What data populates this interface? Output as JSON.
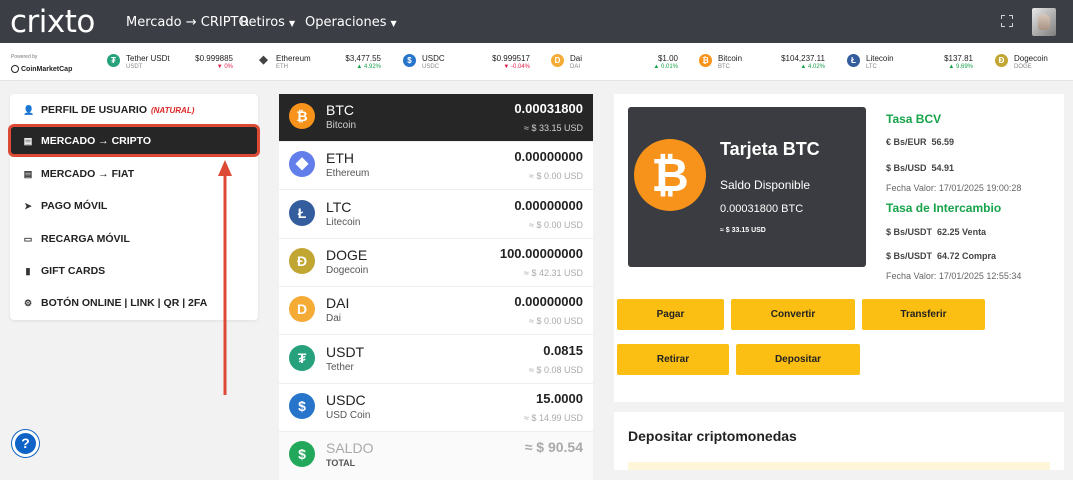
{
  "app": {
    "logo": "crixto",
    "nav": {
      "mercado": "Mercado → CRIPTO",
      "retiros": "Retiros",
      "operaciones": "Operaciones"
    }
  },
  "ticker": {
    "powered_by": "Powered by",
    "provider": "CoinMarketCap",
    "items": [
      {
        "name": "Tether USDt",
        "symbol": "USDT",
        "price": "$0.999885",
        "change": "▼ 0%",
        "dir": "down",
        "color": "#26a17b"
      },
      {
        "name": "Ethereum",
        "symbol": "ETH",
        "price": "$3,477.55",
        "change": "▲ 4.92%",
        "dir": "up",
        "color": "#627eea"
      },
      {
        "name": "USDC",
        "symbol": "USDC",
        "price": "$0.999517",
        "change": "▼ -0.04%",
        "dir": "down",
        "color": "#2775ca"
      },
      {
        "name": "Dai",
        "symbol": "DAI",
        "price": "$1.00",
        "change": "▲ 0.01%",
        "dir": "up",
        "color": "#f5ac37"
      },
      {
        "name": "Bitcoin",
        "symbol": "BTC",
        "price": "$104,237.11",
        "change": "▲ 4.02%",
        "dir": "up",
        "color": "#f7931a"
      },
      {
        "name": "Litecoin",
        "symbol": "LTC",
        "price": "$137.81",
        "change": "▲ 9.69%",
        "dir": "up",
        "color": "#345d9d"
      },
      {
        "name": "Dogecoin",
        "symbol": "DOGE",
        "price": "",
        "change": "",
        "dir": "up",
        "color": "#c2a633"
      }
    ]
  },
  "sidebar": {
    "items": [
      {
        "label": "PERFIL DE USUARIO",
        "tag": "(NATURAL)"
      },
      {
        "label": "MERCADO → CRIPTO"
      },
      {
        "label": "MERCADO → FIAT"
      },
      {
        "label": "PAGO MÓVIL"
      },
      {
        "label": "RECARGA MÓVIL"
      },
      {
        "label": "GIFT CARDS"
      },
      {
        "label": "BOTÓN ONLINE | LINK | QR | 2FA"
      }
    ]
  },
  "wallet": {
    "coins": [
      {
        "symbol": "BTC",
        "name": "Bitcoin",
        "amount": "0.00031800",
        "usd": "≈ $ 33.15 USD",
        "color": "#f7931a",
        "glyph": "₿"
      },
      {
        "symbol": "ETH",
        "name": "Ethereum",
        "amount": "0.00000000",
        "usd": "≈ $ 0.00 USD",
        "color": "#627eea",
        "glyph": "◆"
      },
      {
        "symbol": "LTC",
        "name": "Litecoin",
        "amount": "0.00000000",
        "usd": "≈ $ 0.00 USD",
        "color": "#345d9d",
        "glyph": "Ł"
      },
      {
        "symbol": "DOGE",
        "name": "Dogecoin",
        "amount": "100.00000000",
        "usd": "≈ $ 42.31 USD",
        "color": "#c2a633",
        "glyph": "Ð"
      },
      {
        "symbol": "DAI",
        "name": "Dai",
        "amount": "0.00000000",
        "usd": "≈ $ 0.00 USD",
        "color": "#f5ac37",
        "glyph": "D"
      },
      {
        "symbol": "USDT",
        "name": "Tether",
        "amount": "0.0815",
        "usd": "≈ $ 0.08 USD",
        "color": "#26a17b",
        "glyph": "₮"
      },
      {
        "symbol": "USDC",
        "name": "USD Coin",
        "amount": "15.0000",
        "usd": "≈ $ 14.99 USD",
        "color": "#2775ca",
        "glyph": "$"
      }
    ],
    "total": {
      "label": "SALDO",
      "sub": "TOTAL",
      "amount": "≈ $ 90.54",
      "color": "#22a85a",
      "glyph": "$"
    }
  },
  "card": {
    "title": "Tarjeta BTC",
    "balance_label": "Saldo Disponible",
    "balance": "0.00031800 BTC",
    "balance_usd": "≈ $ 33.15 USD"
  },
  "rates": {
    "bcv_title": "Tasa BCV",
    "eur_label": "€ Bs/EUR",
    "eur_value": "56.59",
    "usd_label": "$ Bs/USD",
    "usd_value": "54.91",
    "bcv_date": "Fecha Valor: 17/01/2025 19:00:28",
    "exchange_title": "Tasa de Intercambio",
    "sell_label": "$ Bs/USDT",
    "sell_value": "62.25 Venta",
    "buy_label": "$ Bs/USDT",
    "buy_value": "64.72 Compra",
    "exchange_date": "Fecha Valor: 17/01/2025 12:55:34"
  },
  "actions": {
    "pagar": "Pagar",
    "convertir": "Convertir",
    "transferir": "Transferir",
    "retirar": "Retirar",
    "depositar": "Depositar"
  },
  "deposit": {
    "title": "Depositar criptomonedas"
  },
  "help": {
    "glyph": "?"
  },
  "colors": {
    "accent": "#fbbf14",
    "annotation": "#dc4a35",
    "navbar": "#3b3e45",
    "active": "#262626",
    "green": "#16a34a"
  }
}
